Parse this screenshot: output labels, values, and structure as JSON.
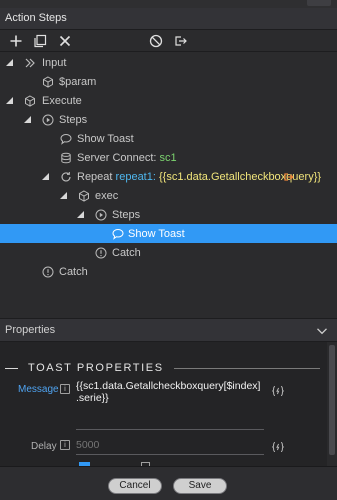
{
  "panel": {
    "title": "Action Steps"
  },
  "toolbar": {
    "add_icon": "plus-icon",
    "copy_icon": "copy-icon",
    "delete_icon": "close-icon",
    "disable_icon": "ban-icon",
    "move_icon": "export-icon"
  },
  "tree": {
    "input": {
      "label": "Input"
    },
    "param": {
      "label": "$param"
    },
    "execute": {
      "label": "Execute"
    },
    "steps": {
      "label": "Steps"
    },
    "show_toast_1": {
      "label": "Show Toast"
    },
    "server_connect": {
      "label": "Server Connect:",
      "value": "sc1"
    },
    "repeat": {
      "label": "Repeat",
      "name": "repeat1:",
      "expr": "{{sc1.data.Getallcheckboxquery}}"
    },
    "exec": {
      "label": "exec"
    },
    "inner_steps": {
      "label": "Steps"
    },
    "show_toast_2": {
      "label": "Show Toast"
    },
    "inner_catch": {
      "label": "Catch"
    },
    "catch": {
      "label": "Catch"
    }
  },
  "properties": {
    "header": "Properties",
    "section_title": "TOAST PROPERTIES",
    "message": {
      "label": "Message",
      "value": "{{sc1.data.Getallcheckboxquery[$index] .serie}}"
    },
    "delay": {
      "label": "Delay",
      "placeholder": "5000"
    }
  },
  "footer": {
    "cancel_label": "Cancel",
    "save_label": "Save"
  },
  "colors": {
    "selected": "#3199f5",
    "accent_green": "#7cd46f",
    "accent_cyan": "#4fb7ee",
    "accent_yellow": "#f0e47a",
    "link_blue": "#4fa3f0"
  }
}
